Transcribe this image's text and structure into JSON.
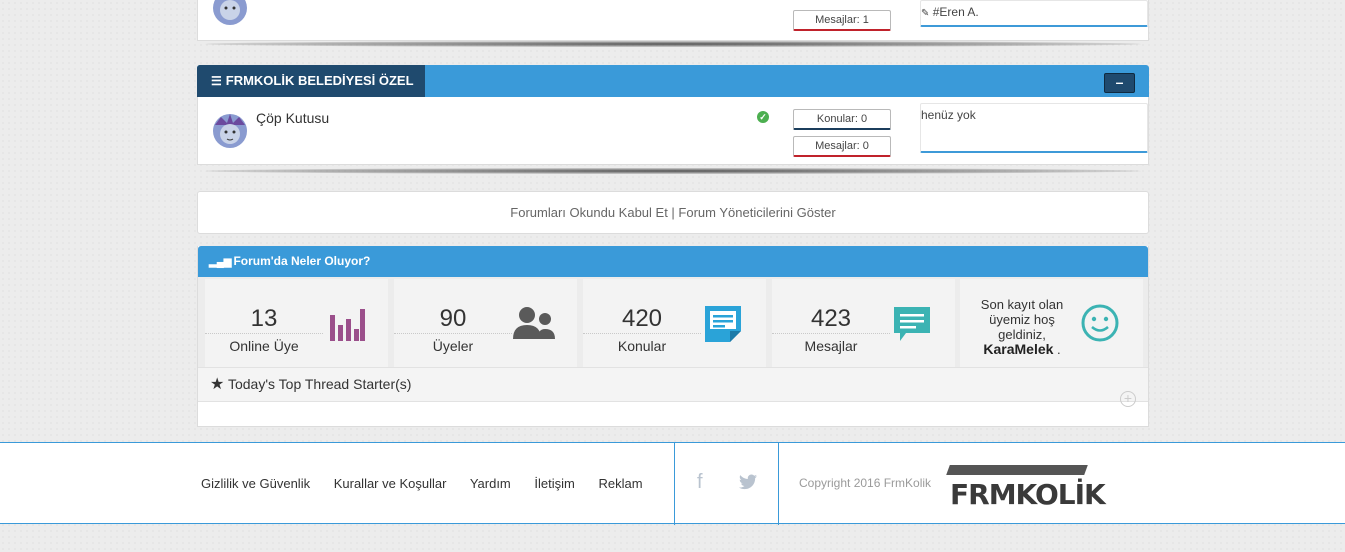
{
  "top_forum": {
    "mesajlar": "Mesajlar: 1",
    "last_post_user": "#Eren A."
  },
  "category": {
    "title": "FRMKOLİK BELEDİYESİ ÖZEL",
    "collapse_label": "–",
    "forum": {
      "name": "Çöp Kutusu",
      "konular": "Konular: 0",
      "mesajlar": "Mesajlar: 0",
      "last_post": "henüz yok"
    }
  },
  "forum_links": "Forumları Okundu Kabul Et | Forum Yöneticilerini Göster",
  "stats": {
    "title": "Forum'da Neler Oluyor?",
    "boxes": [
      {
        "value": "13",
        "label": "Online Üye",
        "icon": "bar-chart-icon",
        "color": "#9b4f8b"
      },
      {
        "value": "90",
        "label": "Üyeler",
        "icon": "users-icon",
        "color": "#5a5a5a"
      },
      {
        "value": "420",
        "label": "Konular",
        "icon": "note-icon",
        "color": "#2aa3d8"
      },
      {
        "value": "423",
        "label": "Mesajlar",
        "icon": "chat-icon",
        "color": "#3bb3b3"
      }
    ],
    "welcome": {
      "text": "Son kayıt olan üyemiz hoş geldiniz,",
      "username": "KaraMelek",
      "suffix": " .",
      "icon": "smile-icon"
    },
    "top_threads": "Today's Top Thread Starter(s)"
  },
  "footer": {
    "links": [
      "Gizlilik ve Güvenlik",
      "Kurallar ve Koşullar",
      "Yardım",
      "İletişim",
      "Reklam"
    ],
    "copyright": "Copyright 2016  FrmKolik",
    "logo_text": "FRMKOLİK"
  }
}
